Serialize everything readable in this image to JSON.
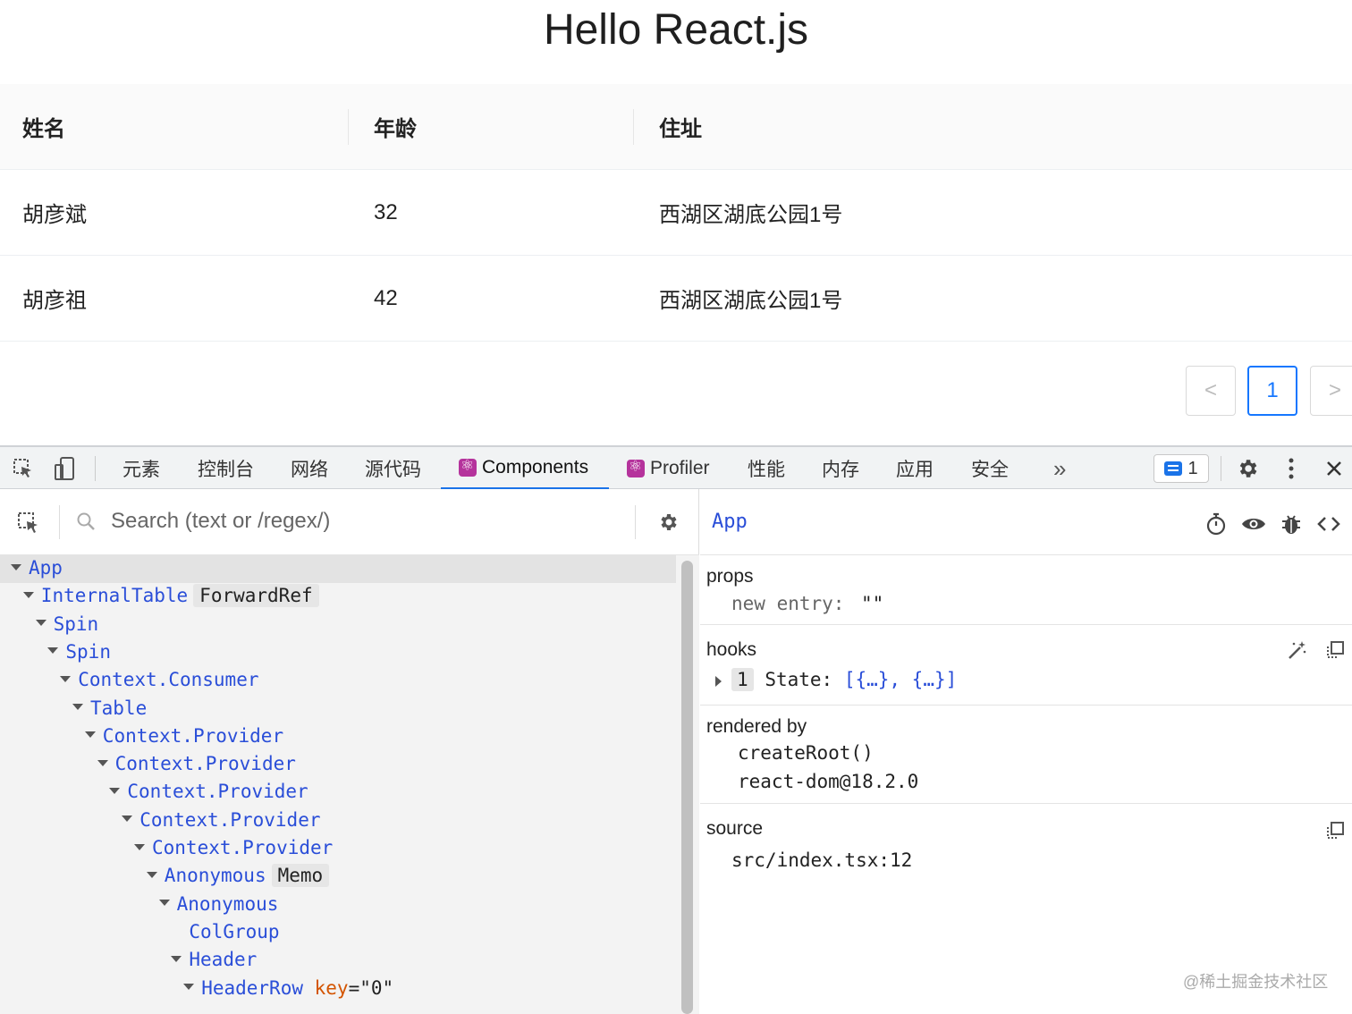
{
  "page": {
    "title": "Hello React.js",
    "table": {
      "headers": [
        "姓名",
        "年龄",
        "住址"
      ],
      "rows": [
        {
          "name": "胡彦斌",
          "age": "32",
          "address": "西湖区湖底公园1号"
        },
        {
          "name": "胡彦祖",
          "age": "42",
          "address": "西湖区湖底公园1号"
        }
      ]
    },
    "pagination": {
      "prev": "<",
      "current": "1",
      "next": ">"
    }
  },
  "devtools": {
    "tabs": [
      "元素",
      "控制台",
      "网络",
      "源代码",
      "Components",
      "Profiler",
      "性能",
      "内存",
      "应用",
      "安全"
    ],
    "active_tab": "Components",
    "more": "»",
    "message_count": "1",
    "accent": "#1a73e8"
  },
  "components": {
    "search_placeholder": "Search (text or /regex/)",
    "tree": [
      {
        "label": "App",
        "depth": 0,
        "caret": true,
        "selected": true
      },
      {
        "label": "InternalTable",
        "badge": "ForwardRef",
        "depth": 1,
        "caret": true
      },
      {
        "label": "Spin",
        "depth": 2,
        "caret": true
      },
      {
        "label": "Spin",
        "depth": 3,
        "caret": true
      },
      {
        "label": "Context.Consumer",
        "depth": 4,
        "caret": true
      },
      {
        "label": "Table",
        "depth": 5,
        "caret": true
      },
      {
        "label": "Context.Provider",
        "depth": 6,
        "caret": true
      },
      {
        "label": "Context.Provider",
        "depth": 7,
        "caret": true
      },
      {
        "label": "Context.Provider",
        "depth": 8,
        "caret": true
      },
      {
        "label": "Context.Provider",
        "depth": 9,
        "caret": true
      },
      {
        "label": "Context.Provider",
        "depth": 10,
        "caret": true
      },
      {
        "label": "Anonymous",
        "badge": "Memo",
        "depth": 11,
        "caret": true
      },
      {
        "label": "Anonymous",
        "depth": 12,
        "caret": true
      },
      {
        "label": "ColGroup",
        "depth": 13,
        "caret": false
      },
      {
        "label": "Header",
        "depth": 13,
        "caret": true
      },
      {
        "label": "HeaderRow",
        "key_name": "key",
        "key_value": "=\"0\"",
        "depth": 14,
        "caret": true
      }
    ],
    "selected_component": "App",
    "props": {
      "title": "props",
      "key": "new entry:",
      "value": "\"\""
    },
    "hooks": {
      "title": "hooks",
      "index": "1",
      "label": "State:",
      "value": "[{…}, {…}]"
    },
    "rendered_by": {
      "title": "rendered by",
      "items": [
        "createRoot()",
        "react-dom@18.2.0"
      ]
    },
    "source": {
      "title": "source",
      "value": "src/index.tsx:12"
    },
    "watermark": "@稀土掘金技术社区"
  }
}
